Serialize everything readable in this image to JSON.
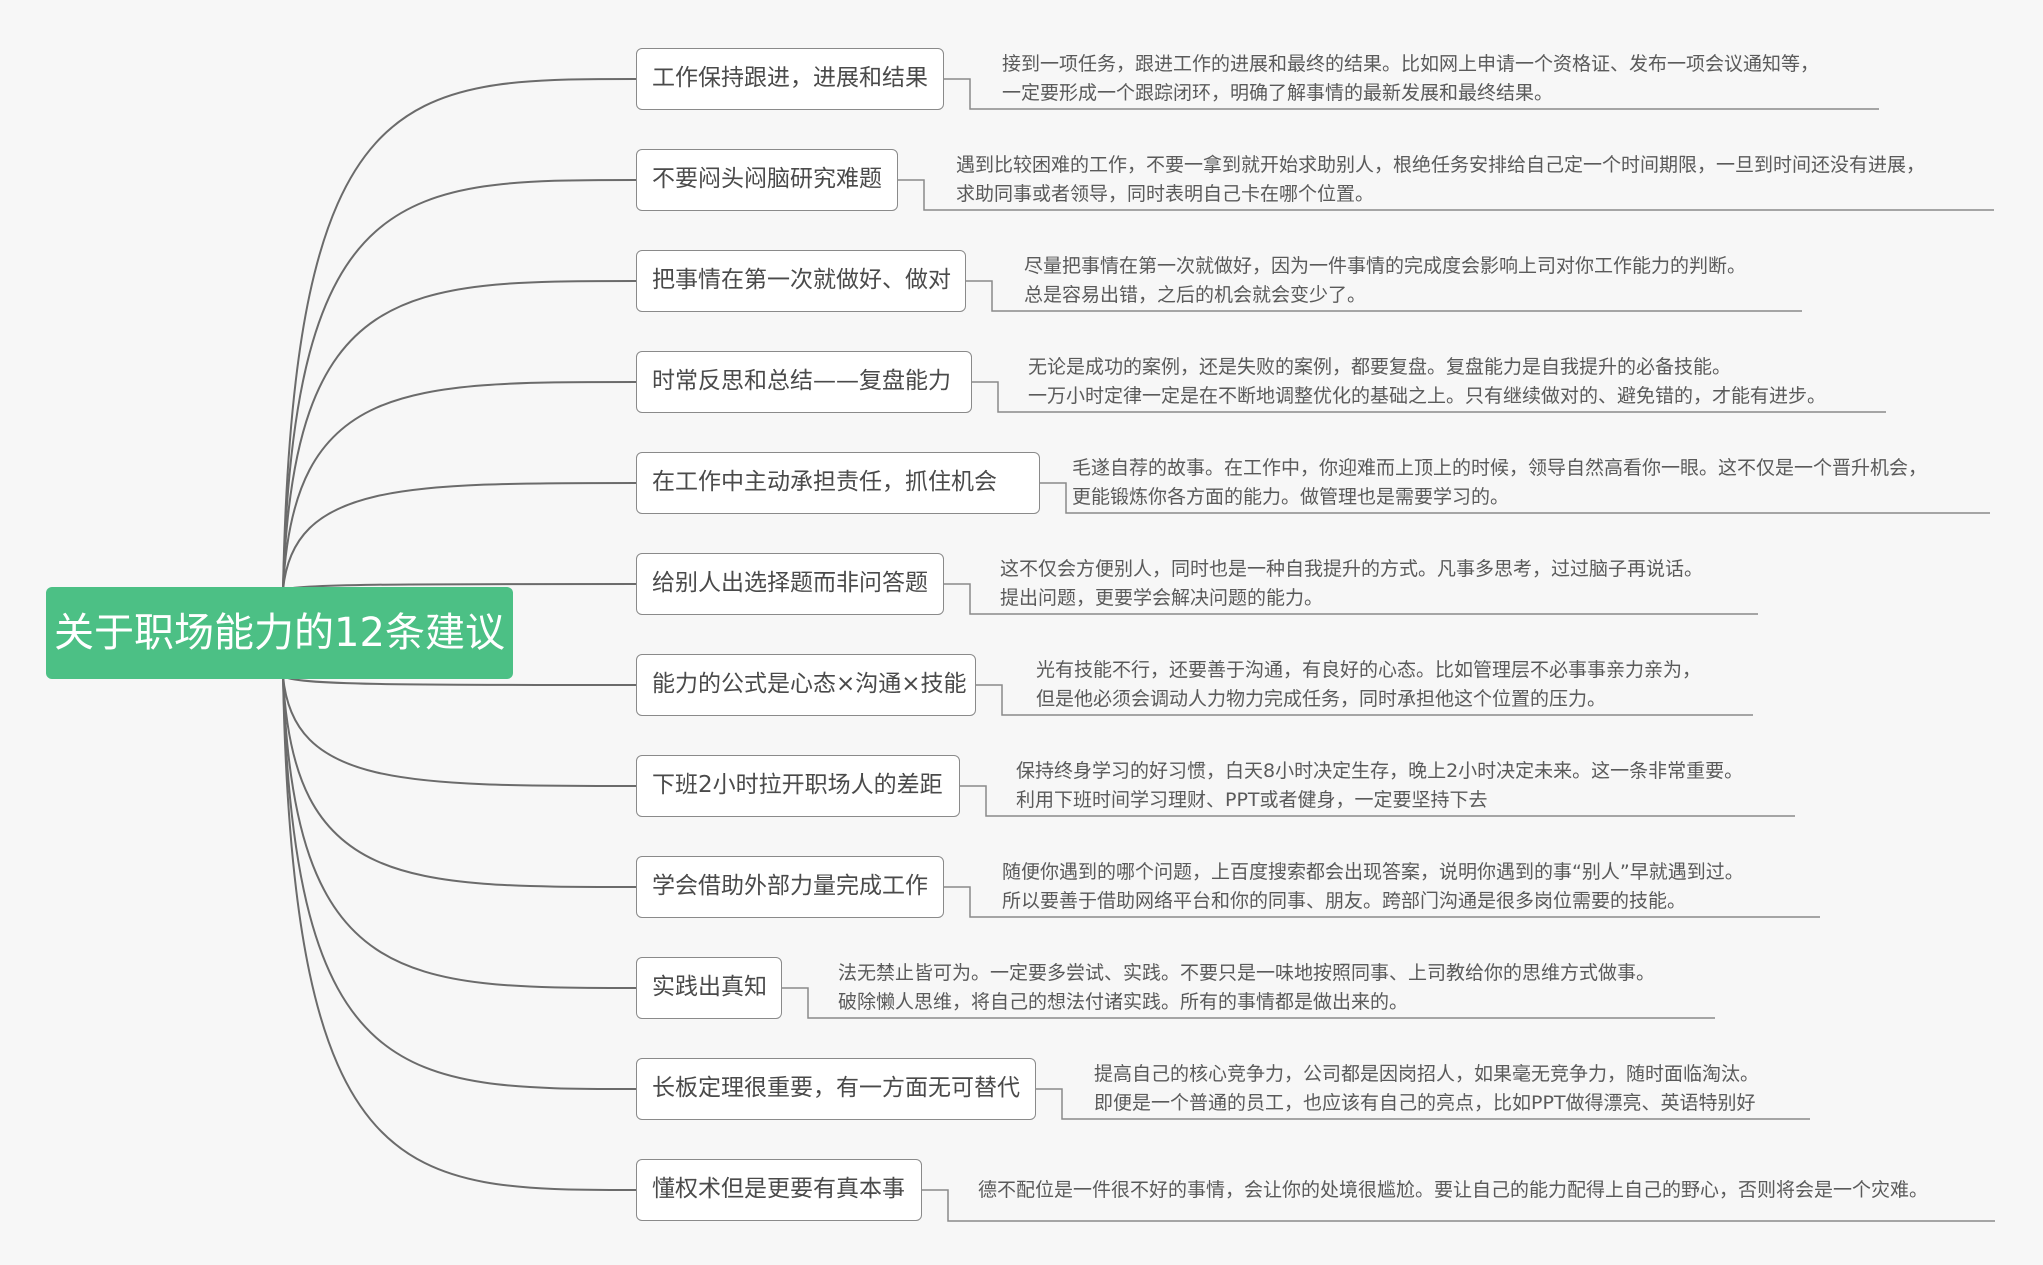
{
  "diagram": {
    "type": "mind-map",
    "root": {
      "label": "关于职场能力的12条建议"
    },
    "branches": [
      {
        "label": "工作保持跟进，进展和结果",
        "details": [
          "接到一项任务，跟进工作的进展和最终的结果。比如网上申请一个资格证、发布一项会议通知等，",
          "一定要形成一个跟踪闭环，明确了解事情的最新发展和最终结果。"
        ]
      },
      {
        "label": "不要闷头闷脑研究难题",
        "details": [
          "遇到比较困难的工作，不要一拿到就开始求助别人，根绝任务安排给自己定一个时间期限，一旦到时间还没有进展，",
          "求助同事或者领导，同时表明自己卡在哪个位置。"
        ]
      },
      {
        "label": "把事情在第一次就做好、做对",
        "details": [
          "尽量把事情在第一次就做好，因为一件事情的完成度会影响上司对你工作能力的判断。",
          "总是容易出错，之后的机会就会变少了。"
        ]
      },
      {
        "label": "时常反思和总结——复盘能力",
        "details": [
          "无论是成功的案例，还是失败的案例，都要复盘。复盘能力是自我提升的必备技能。",
          "一万小时定律一定是在不断地调整优化的基础之上。只有继续做对的、避免错的，才能有进步。"
        ]
      },
      {
        "label": "在工作中主动承担责任，抓住机会",
        "details": [
          "毛遂自荐的故事。在工作中，你迎难而上顶上的时候，领导自然高看你一眼。这不仅是一个晋升机会，",
          "更能锻炼你各方面的能力。做管理也是需要学习的。"
        ]
      },
      {
        "label": "给别人出选择题而非问答题",
        "details": [
          "这不仅会方便别人，同时也是一种自我提升的方式。凡事多思考，过过脑子再说话。",
          "提出问题，更要学会解决问题的能力。"
        ]
      },
      {
        "label": "能力的公式是心态×沟通×技能",
        "details": [
          "光有技能不行，还要善于沟通，有良好的心态。比如管理层不必事事亲力亲为，",
          "但是他必须会调动人力物力完成任务，同时承担他这个位置的压力。"
        ]
      },
      {
        "label": "下班2小时拉开职场人的差距",
        "details": [
          "保持终身学习的好习惯，白天8小时决定生存，晚上2小时决定未来。这一条非常重要。",
          "利用下班时间学习理财、PPT或者健身，一定要坚持下去"
        ]
      },
      {
        "label": "学会借助外部力量完成工作",
        "details": [
          "随便你遇到的哪个问题，上百度搜索都会出现答案，说明你遇到的事“别人”早就遇到过。",
          "所以要善于借助网络平台和你的同事、朋友。跨部门沟通是很多岗位需要的技能。"
        ]
      },
      {
        "label": "实践出真知",
        "details": [
          "法无禁止皆可为。一定要多尝试、实践。不要只是一味地按照同事、上司教给你的思维方式做事。",
          "破除懒人思维，将自己的想法付诸实践。所有的事情都是做出来的。"
        ]
      },
      {
        "label": "长板定理很重要，有一方面无可替代",
        "details": [
          "提高自己的核心竞争力，公司都是因岗招人，如果毫无竞争力，随时面临淘汰。",
          "即便是一个普通的员工，也应该有自己的亮点，比如PPT做得漂亮、英语特别好"
        ]
      },
      {
        "label": "懂权术但是更要有真本事",
        "details": [
          "德不配位是一件很不好的事情，会让你的处境很尴尬。要让自己的能力配得上自己的野心，否则将会是一个灾难。"
        ]
      }
    ],
    "colors": {
      "root": "#4cc085",
      "connector": "#6b6b6b",
      "box_border": "#8a8a8a",
      "text": "#4a4a4a"
    }
  }
}
